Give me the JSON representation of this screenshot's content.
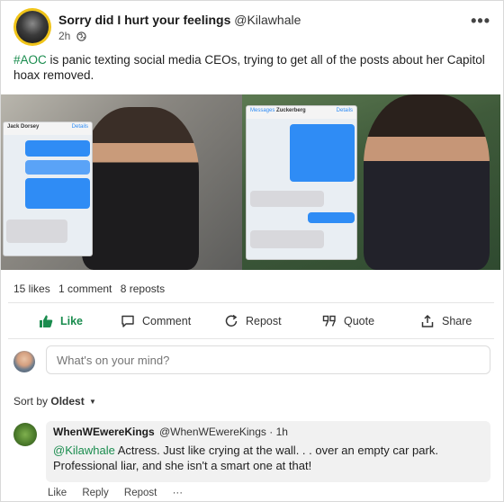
{
  "post": {
    "author_name": "Sorry did I hurt your feelings",
    "author_handle": "@Kilawhale",
    "time": "2h",
    "globe_icon": "globe-icon",
    "more_label": "•••",
    "hashtag": "#AOC",
    "text_rest": " is panic texting social media CEOs, trying to get all of the posts about her Capitol hoax removed.",
    "image": {
      "left_phone": {
        "contact": "Jack Dorsey",
        "details": "Details",
        "messages": [
          "#MeandHerColleagues at a trending right now",
          "YOU BETTER CENSOR THIS IMMEDIATELY!!!!",
          "If you don't I will go on Instagram Live later and tell everyone that Twitter is LITERALLY white supremacy",
          "Sorry, just finished a kombucha enema, will take care of this"
        ]
      },
      "right_phone": {
        "back": "Messages",
        "contact": "Zuckerberg",
        "details": "Details",
        "messages": [
          "Hey Zuckerberg, are you just going to let all these facebook meme groups post memes of me faking the attack SHOULD DO SOMETHING CENSOR THEM!!!",
          "01010010101010101011 1010101010101010101",
          "What the f ...",
          "01010000101010110001 10100010101011000101"
        ]
      }
    }
  },
  "stats": {
    "likes": "15 likes",
    "comments": "1 comment",
    "reposts": "8 reposts"
  },
  "actions": {
    "like": "Like",
    "comment": "Comment",
    "repost": "Repost",
    "quote": "Quote",
    "share": "Share"
  },
  "composer": {
    "placeholder": "What's on your mind?"
  },
  "sort": {
    "label": "Sort by",
    "value": "Oldest"
  },
  "comment": {
    "name": "WhenWEwereKings",
    "handle": "@WhenWEwereKings",
    "time": "· 1h",
    "mention": "@Kilawhale",
    "text_rest": " Actress. Just like crying at the wall. . . over an empty car park. Professional liar, and she isn't a smart one at that!",
    "actions": {
      "like": "Like",
      "reply": "Reply",
      "repost": "Repost",
      "more": "···"
    }
  },
  "colors": {
    "accent": "#1a8c4e",
    "avatar_ring": "#f0c419"
  }
}
